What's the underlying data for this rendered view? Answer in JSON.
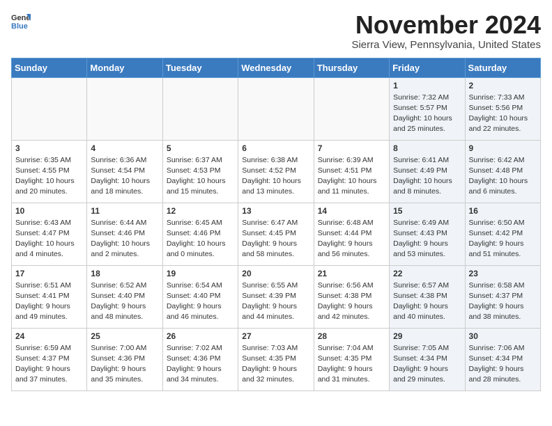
{
  "header": {
    "logo_line1": "General",
    "logo_line2": "Blue",
    "month_title": "November 2024",
    "location": "Sierra View, Pennsylvania, United States"
  },
  "days_of_week": [
    "Sunday",
    "Monday",
    "Tuesday",
    "Wednesday",
    "Thursday",
    "Friday",
    "Saturday"
  ],
  "weeks": [
    [
      {
        "day": "",
        "info": "",
        "empty": true
      },
      {
        "day": "",
        "info": "",
        "empty": true
      },
      {
        "day": "",
        "info": "",
        "empty": true
      },
      {
        "day": "",
        "info": "",
        "empty": true
      },
      {
        "day": "",
        "info": "",
        "empty": true
      },
      {
        "day": "1",
        "info": "Sunrise: 7:32 AM\nSunset: 5:57 PM\nDaylight: 10 hours and 25 minutes.",
        "shaded": true
      },
      {
        "day": "2",
        "info": "Sunrise: 7:33 AM\nSunset: 5:56 PM\nDaylight: 10 hours and 22 minutes.",
        "shaded": true
      }
    ],
    [
      {
        "day": "3",
        "info": "Sunrise: 6:35 AM\nSunset: 4:55 PM\nDaylight: 10 hours and 20 minutes."
      },
      {
        "day": "4",
        "info": "Sunrise: 6:36 AM\nSunset: 4:54 PM\nDaylight: 10 hours and 18 minutes."
      },
      {
        "day": "5",
        "info": "Sunrise: 6:37 AM\nSunset: 4:53 PM\nDaylight: 10 hours and 15 minutes."
      },
      {
        "day": "6",
        "info": "Sunrise: 6:38 AM\nSunset: 4:52 PM\nDaylight: 10 hours and 13 minutes."
      },
      {
        "day": "7",
        "info": "Sunrise: 6:39 AM\nSunset: 4:51 PM\nDaylight: 10 hours and 11 minutes."
      },
      {
        "day": "8",
        "info": "Sunrise: 6:41 AM\nSunset: 4:49 PM\nDaylight: 10 hours and 8 minutes.",
        "shaded": true
      },
      {
        "day": "9",
        "info": "Sunrise: 6:42 AM\nSunset: 4:48 PM\nDaylight: 10 hours and 6 minutes.",
        "shaded": true
      }
    ],
    [
      {
        "day": "10",
        "info": "Sunrise: 6:43 AM\nSunset: 4:47 PM\nDaylight: 10 hours and 4 minutes."
      },
      {
        "day": "11",
        "info": "Sunrise: 6:44 AM\nSunset: 4:46 PM\nDaylight: 10 hours and 2 minutes."
      },
      {
        "day": "12",
        "info": "Sunrise: 6:45 AM\nSunset: 4:46 PM\nDaylight: 10 hours and 0 minutes."
      },
      {
        "day": "13",
        "info": "Sunrise: 6:47 AM\nSunset: 4:45 PM\nDaylight: 9 hours and 58 minutes."
      },
      {
        "day": "14",
        "info": "Sunrise: 6:48 AM\nSunset: 4:44 PM\nDaylight: 9 hours and 56 minutes."
      },
      {
        "day": "15",
        "info": "Sunrise: 6:49 AM\nSunset: 4:43 PM\nDaylight: 9 hours and 53 minutes.",
        "shaded": true
      },
      {
        "day": "16",
        "info": "Sunrise: 6:50 AM\nSunset: 4:42 PM\nDaylight: 9 hours and 51 minutes.",
        "shaded": true
      }
    ],
    [
      {
        "day": "17",
        "info": "Sunrise: 6:51 AM\nSunset: 4:41 PM\nDaylight: 9 hours and 49 minutes."
      },
      {
        "day": "18",
        "info": "Sunrise: 6:52 AM\nSunset: 4:40 PM\nDaylight: 9 hours and 48 minutes."
      },
      {
        "day": "19",
        "info": "Sunrise: 6:54 AM\nSunset: 4:40 PM\nDaylight: 9 hours and 46 minutes."
      },
      {
        "day": "20",
        "info": "Sunrise: 6:55 AM\nSunset: 4:39 PM\nDaylight: 9 hours and 44 minutes."
      },
      {
        "day": "21",
        "info": "Sunrise: 6:56 AM\nSunset: 4:38 PM\nDaylight: 9 hours and 42 minutes."
      },
      {
        "day": "22",
        "info": "Sunrise: 6:57 AM\nSunset: 4:38 PM\nDaylight: 9 hours and 40 minutes.",
        "shaded": true
      },
      {
        "day": "23",
        "info": "Sunrise: 6:58 AM\nSunset: 4:37 PM\nDaylight: 9 hours and 38 minutes.",
        "shaded": true
      }
    ],
    [
      {
        "day": "24",
        "info": "Sunrise: 6:59 AM\nSunset: 4:37 PM\nDaylight: 9 hours and 37 minutes."
      },
      {
        "day": "25",
        "info": "Sunrise: 7:00 AM\nSunset: 4:36 PM\nDaylight: 9 hours and 35 minutes."
      },
      {
        "day": "26",
        "info": "Sunrise: 7:02 AM\nSunset: 4:36 PM\nDaylight: 9 hours and 34 minutes."
      },
      {
        "day": "27",
        "info": "Sunrise: 7:03 AM\nSunset: 4:35 PM\nDaylight: 9 hours and 32 minutes."
      },
      {
        "day": "28",
        "info": "Sunrise: 7:04 AM\nSunset: 4:35 PM\nDaylight: 9 hours and 31 minutes."
      },
      {
        "day": "29",
        "info": "Sunrise: 7:05 AM\nSunset: 4:34 PM\nDaylight: 9 hours and 29 minutes.",
        "shaded": true
      },
      {
        "day": "30",
        "info": "Sunrise: 7:06 AM\nSunset: 4:34 PM\nDaylight: 9 hours and 28 minutes.",
        "shaded": true
      }
    ]
  ]
}
